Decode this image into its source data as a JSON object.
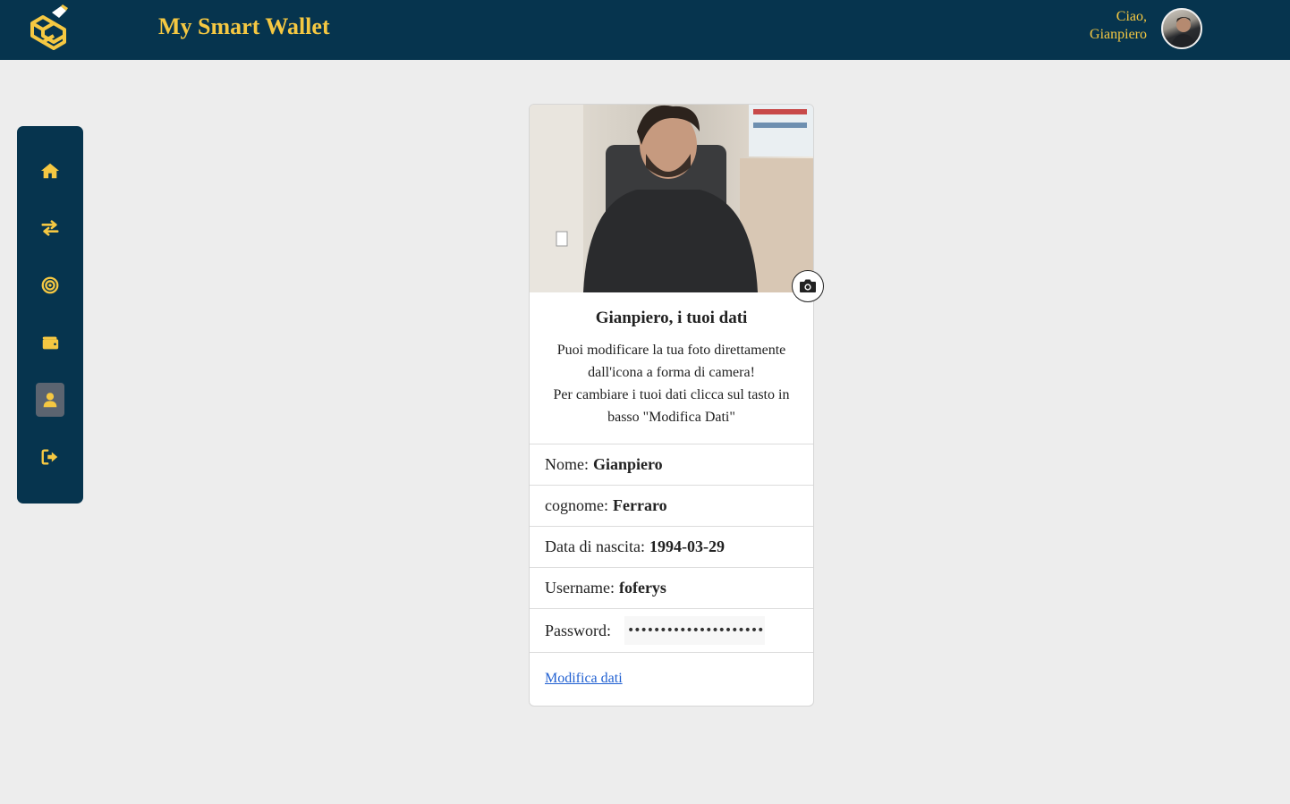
{
  "header": {
    "app_title": "My Smart Wallet",
    "greeting_line1": "Ciao,",
    "greeting_line2": "Gianpiero"
  },
  "colors": {
    "navbar": "#06344e",
    "accent": "#f5c842",
    "background": "#ededed",
    "link": "#1f5fd1"
  },
  "sidebar": {
    "items": [
      {
        "icon": "home-icon",
        "active": false
      },
      {
        "icon": "transfer-arrows-icon",
        "active": false
      },
      {
        "icon": "target-icon",
        "active": false
      },
      {
        "icon": "wallet-icon",
        "active": false
      },
      {
        "icon": "user-profile-icon",
        "active": true
      },
      {
        "icon": "logout-icon",
        "active": false
      }
    ]
  },
  "profile": {
    "title": "Gianpiero, i tuoi dati",
    "description_lines": [
      "Puoi modificare la tua foto direttamente",
      "dall'icona a forma di camera!",
      "Per cambiare i tuoi dati clicca sul tasto in",
      "basso \"Modifica Dati\""
    ],
    "fields": {
      "nome_label": "Nome:",
      "nome_value": "Gianpiero",
      "cognome_label": "cognome:",
      "cognome_value": "Ferraro",
      "nascita_label": "Data di nascita:",
      "nascita_value": "1994-03-29",
      "username_label": "Username:",
      "username_value": "foferys",
      "password_label": "Password:",
      "password_value": "••••••••••••••••••••••"
    },
    "edit_link": "Modifica dati"
  }
}
